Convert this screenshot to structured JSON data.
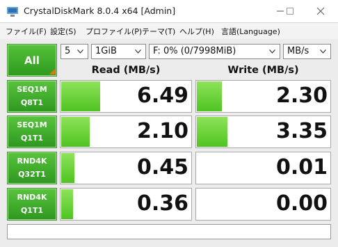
{
  "window": {
    "title": "CrystalDiskMark 8.0.4 x64 [Admin]"
  },
  "menu": [
    {
      "label": "ファイル(F)"
    },
    {
      "label": "設定(S)"
    },
    {
      "label": "プロファイル(P)"
    },
    {
      "label": "テーマ(T)"
    },
    {
      "label": "ヘルプ(H)"
    },
    {
      "label": "言語(Language)"
    }
  ],
  "controls": {
    "all_label": "All",
    "count": "5",
    "size": "1GiB",
    "drive": "F: 0% (0/7998MiB)",
    "unit": "MB/s"
  },
  "headers": {
    "read": "Read (MB/s)",
    "write": "Write (MB/s)"
  },
  "tests": [
    {
      "line1": "SEQ1M",
      "line2": "Q8T1",
      "read": "6.49",
      "write": "2.30",
      "read_fill": 0.3,
      "write_fill": 0.19
    },
    {
      "line1": "SEQ1M",
      "line2": "Q1T1",
      "read": "2.10",
      "write": "3.35",
      "read_fill": 0.22,
      "write_fill": 0.23
    },
    {
      "line1": "RND4K",
      "line2": "Q32T1",
      "read": "0.45",
      "write": "0.01",
      "read_fill": 0.1,
      "write_fill": 0.0
    },
    {
      "line1": "RND4K",
      "line2": "Q1T1",
      "read": "0.36",
      "write": "0.00",
      "read_fill": 0.09,
      "write_fill": 0.0
    }
  ],
  "comment": "",
  "colors": {
    "button_green": "#3aaa28",
    "bar_green": "#6fd43c"
  }
}
